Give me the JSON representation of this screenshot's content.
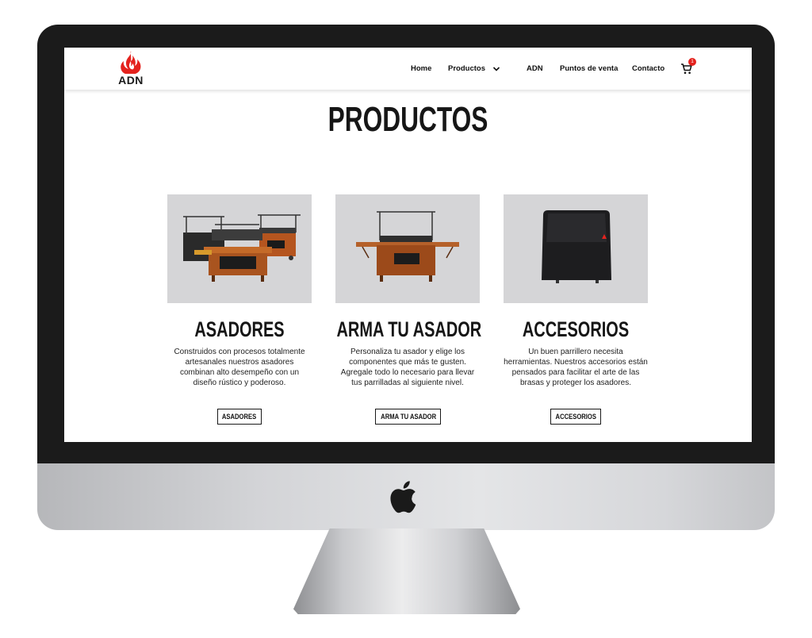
{
  "brand": {
    "name": "ADN",
    "accent": "#e4231e"
  },
  "nav": {
    "items": [
      {
        "label": "Home"
      },
      {
        "label": "Productos"
      },
      {
        "label": "ADN"
      },
      {
        "label": "Puntos de venta"
      },
      {
        "label": "Contacto"
      }
    ],
    "cart_count": "1"
  },
  "page": {
    "title": "PRODUCTOS"
  },
  "cards": [
    {
      "title": "ASADORES",
      "description": "Construidos con procesos totalmente artesanales nuestros asadores combinan alto desempeño con un diseño rústico y poderoso.",
      "button": "ASADORES"
    },
    {
      "title": "ARMA TU ASADOR",
      "description": "Personaliza tu asador y elige los componentes que más te gusten. Agregale todo lo necesario para llevar tus parrilladas al siguiente nivel.",
      "button": "ARMA TU ASADOR"
    },
    {
      "title": "ACCESORIOS",
      "description": "Un buen parrillero necesita herramientas. Nuestros accesorios están pensados para facilitar el arte de las brasas y proteger los asadores.",
      "button": "ACCESORIOS"
    }
  ]
}
